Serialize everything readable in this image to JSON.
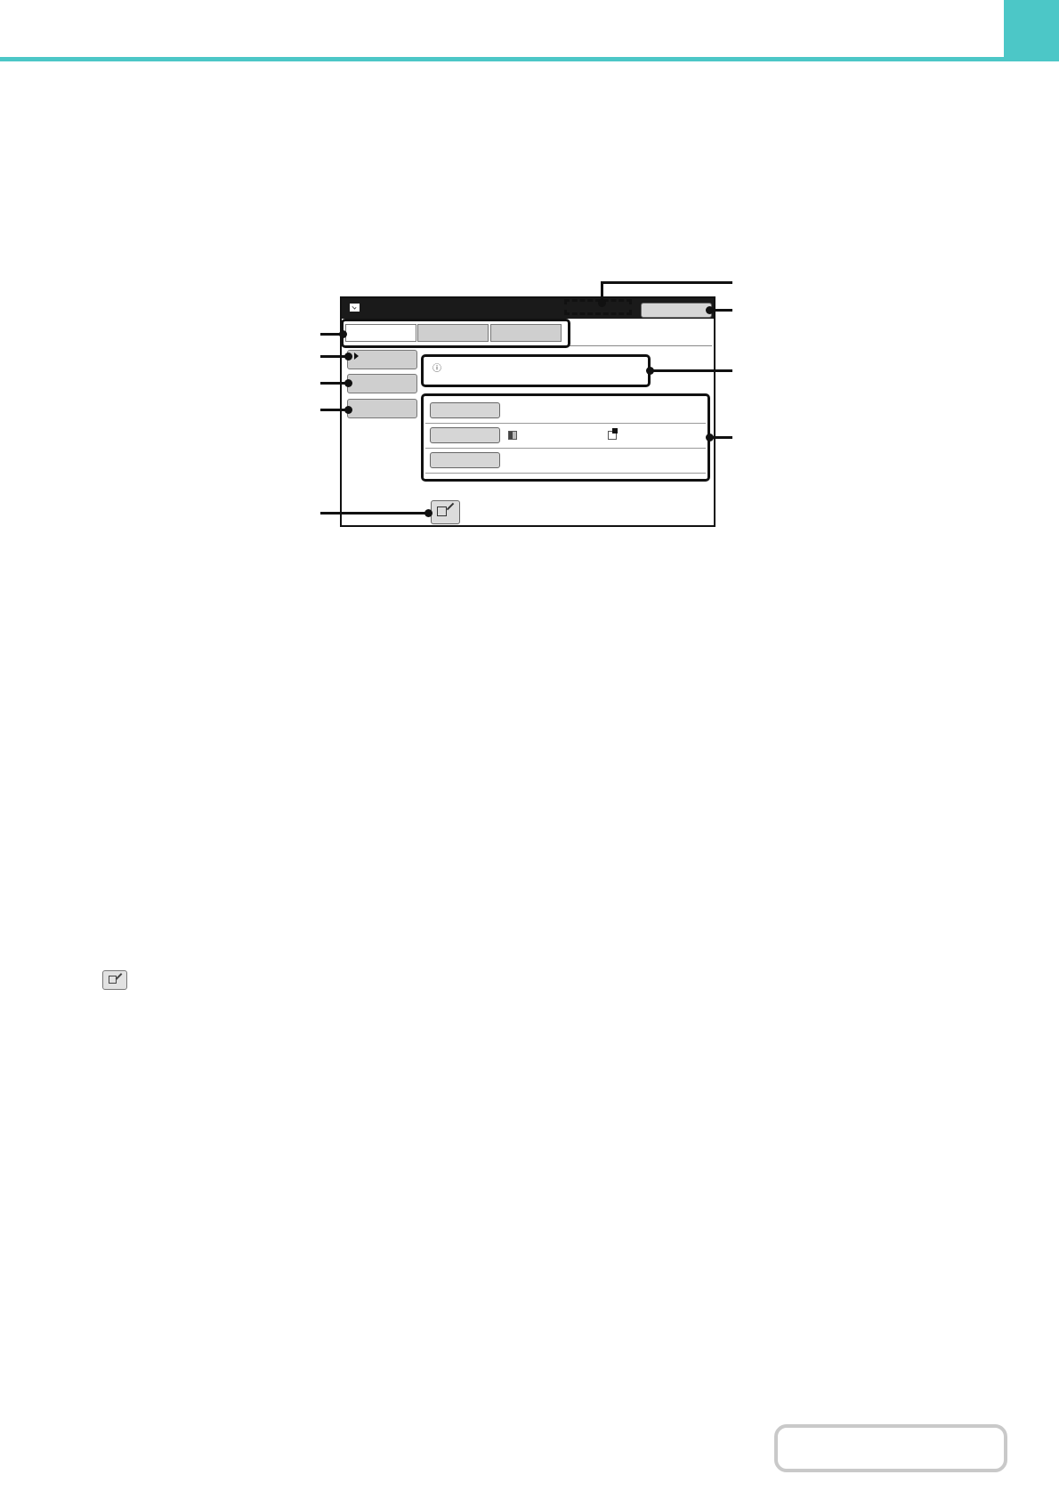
{
  "colors": {
    "accent": "#4cc7c7",
    "frame": "#111111",
    "button_gray": "#cfcfcf"
  },
  "icons": {
    "titlebar": "mail-icon",
    "message": "info-icon",
    "bottom_button": "edit-pencil-icon",
    "settings_row2_left": "checker-grid-icon",
    "settings_row2_right": "corner-square-icon"
  }
}
